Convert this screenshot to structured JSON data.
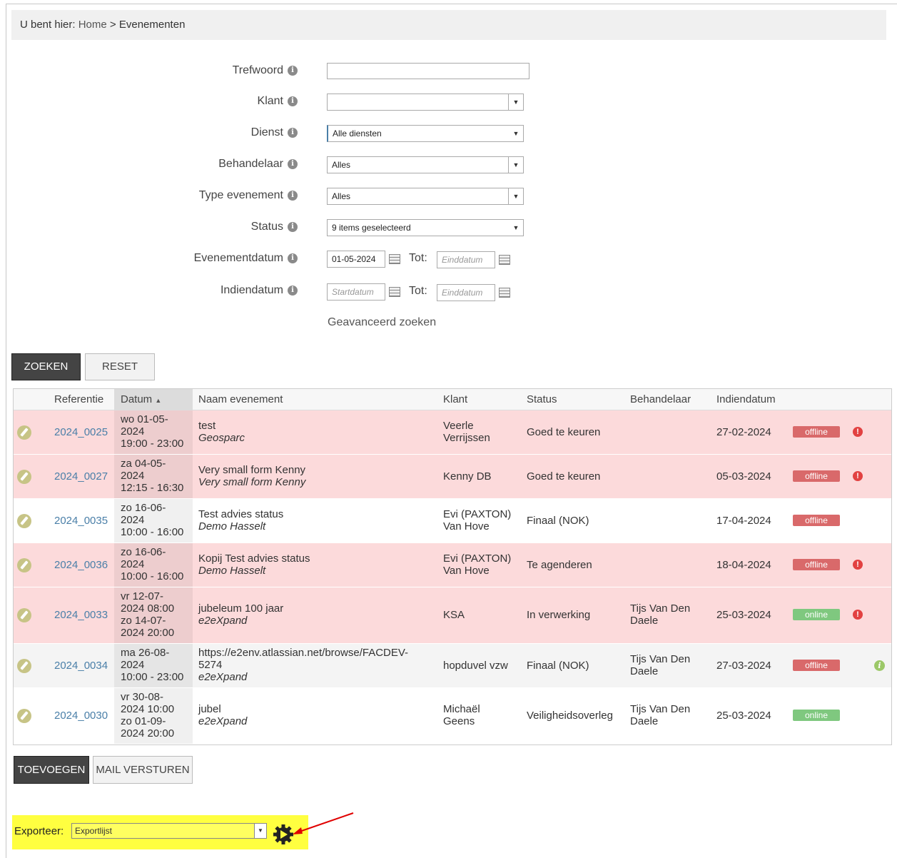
{
  "breadcrumb": {
    "prefix": "U bent hier:",
    "home": "Home",
    "separator": ">",
    "current": "Evenementen"
  },
  "form": {
    "trefwoord_label": "Trefwoord",
    "trefwoord_value": "",
    "klant_label": "Klant",
    "klant_value": "",
    "dienst_label": "Dienst",
    "dienst_value": "Alle diensten",
    "behandelaar_label": "Behandelaar",
    "behandelaar_value": "Alles",
    "type_label": "Type evenement",
    "type_value": "Alles",
    "status_label": "Status",
    "status_value": "9 items geselecteerd",
    "evenementdatum_label": "Evenementdatum",
    "evenementdatum_start": "01-05-2024",
    "tot_label": "Tot:",
    "end_placeholder": "Einddatum",
    "indiendatum_label": "Indiendatum",
    "start_placeholder": "Startdatum",
    "advanced_link": "Geavanceerd zoeken"
  },
  "buttons": {
    "zoeken": "ZOEKEN",
    "reset": "RESET",
    "toevoegen": "TOEVOEGEN",
    "mail": "MAIL VERSTUREN"
  },
  "table": {
    "headers": {
      "referentie": "Referentie",
      "datum": "Datum",
      "sort_glyph": "▲",
      "naam": "Naam evenement",
      "klant": "Klant",
      "status": "Status",
      "behandelaar": "Behandelaar",
      "indiendatum": "Indiendatum"
    },
    "rows": [
      {
        "ref": "2024_0025",
        "date1": "wo 01-05-",
        "date2": "2024",
        "date3": "19:00 - 23:00",
        "date4": "",
        "naam": "test",
        "naam2": "",
        "sub": "Geosparc",
        "klant1": "Veerle",
        "klant2": "Verrijssen",
        "status": "Goed te keuren",
        "beh1": "",
        "beh2": "",
        "indien": "27-02-2024",
        "badge": "offline",
        "warn": "!"
      },
      {
        "ref": "2024_0027",
        "date1": "za 04-05-",
        "date2": "2024",
        "date3": "12:15 - 16:30",
        "date4": "",
        "naam": "Very small form Kenny",
        "naam2": "",
        "sub": "Very small form Kenny",
        "klant1": "Kenny DB",
        "klant2": "",
        "status": "Goed te keuren",
        "beh1": "",
        "beh2": "",
        "indien": "05-03-2024",
        "badge": "offline",
        "warn": "!"
      },
      {
        "ref": "2024_0035",
        "date1": "zo 16-06-",
        "date2": "2024",
        "date3": "10:00 - 16:00",
        "date4": "",
        "naam": "Test advies status",
        "naam2": "",
        "sub": "Demo Hasselt",
        "klant1": "Evi (PAXTON)",
        "klant2": "Van Hove",
        "status": "Finaal (NOK)",
        "beh1": "",
        "beh2": "",
        "indien": "17-04-2024",
        "badge": "offline",
        "warn": ""
      },
      {
        "ref": "2024_0036",
        "date1": "zo 16-06-",
        "date2": "2024",
        "date3": "10:00 - 16:00",
        "date4": "",
        "naam": "Kopij Test advies status",
        "naam2": "",
        "sub": "Demo Hasselt",
        "klant1": "Evi (PAXTON)",
        "klant2": "Van Hove",
        "status": "Te agenderen",
        "beh1": "",
        "beh2": "",
        "indien": "18-04-2024",
        "badge": "offline",
        "warn": "!"
      },
      {
        "ref": "2024_0033",
        "date1": "vr 12-07-",
        "date2": "2024 08:00",
        "date3": "zo 14-07-",
        "date4": "2024 20:00",
        "naam": "jubeleum 100 jaar",
        "naam2": "",
        "sub": "e2eXpand",
        "klant1": "KSA",
        "klant2": "",
        "status": "In verwerking",
        "beh1": "Tijs Van Den",
        "beh2": "Daele",
        "indien": "25-03-2024",
        "badge": "online",
        "warn": "!"
      },
      {
        "ref": "2024_0034",
        "date1": "ma 26-08-",
        "date2": "2024",
        "date3": "10:00 - 23:00",
        "date4": "",
        "naam": "https://e2env.atlassian.net/browse/FACDEV-",
        "naam2": "5274",
        "sub": "e2eXpand",
        "klant1": "hopduvel vzw",
        "klant2": "",
        "status": "Finaal (NOK)",
        "beh1": "Tijs Van Den",
        "beh2": "Daele",
        "indien": "27-03-2024",
        "badge": "offline",
        "warn": "",
        "info": "i"
      },
      {
        "ref": "2024_0030",
        "date1": "vr 30-08-",
        "date2": "2024 10:00",
        "date3": "zo 01-09-",
        "date4": "2024 20:00",
        "naam": "jubel",
        "naam2": "",
        "sub": "e2eXpand",
        "klant1": "Michaël",
        "klant2": "Geens",
        "status": "Veiligheidsoverleg",
        "beh1": "Tijs Van Den",
        "beh2": "Daele",
        "indien": "25-03-2024",
        "badge": "online",
        "warn": ""
      }
    ]
  },
  "export": {
    "label": "Exporteer:",
    "value": "Exportlijst"
  },
  "colors": {
    "row_alert": "#fcdadb",
    "badge_offline": "#d9696a",
    "badge_online": "#7fc87f",
    "highlight": "#ffff40",
    "arrow": "#e00000"
  }
}
